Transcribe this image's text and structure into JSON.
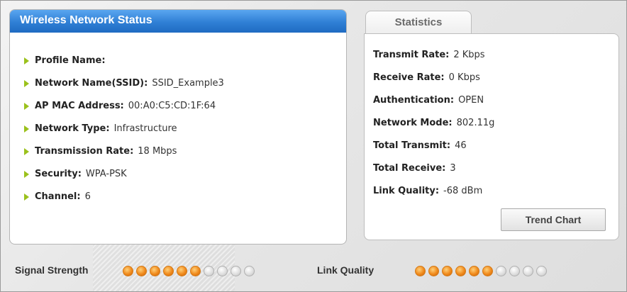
{
  "wireless_status": {
    "title": "Wireless Network Status",
    "items": [
      {
        "label": "Profile Name:",
        "value": ""
      },
      {
        "label": "Network Name(SSID):",
        "value": "SSID_Example3"
      },
      {
        "label": "AP MAC Address:",
        "value": "00:A0:C5:CD:1F:64"
      },
      {
        "label": "Network Type:",
        "value": "Infrastructure"
      },
      {
        "label": "Transmission Rate:",
        "value": "18 Mbps"
      },
      {
        "label": "Security:",
        "value": "WPA-PSK"
      },
      {
        "label": "Channel:",
        "value": "6"
      }
    ]
  },
  "statistics": {
    "tab_label": "Statistics",
    "items": [
      {
        "label": "Transmit Rate:",
        "value": "2 Kbps"
      },
      {
        "label": "Receive Rate:",
        "value": "0 Kbps"
      },
      {
        "label": "Authentication:",
        "value": "OPEN"
      },
      {
        "label": "Network Mode:",
        "value": "802.11g"
      },
      {
        "label": "Total Transmit:",
        "value": "46"
      },
      {
        "label": "Total Receive:",
        "value": "3"
      },
      {
        "label": "Link Quality:",
        "value": "-68 dBm"
      }
    ],
    "trend_chart_label": "Trend Chart"
  },
  "meters": {
    "signal_strength": {
      "label": "Signal Strength",
      "level": 6,
      "total": 10
    },
    "link_quality": {
      "label": "Link Quality",
      "level": 6,
      "total": 10
    }
  },
  "colors": {
    "header_blue": "#2f7fd5",
    "bullet_green": "#9bc11c",
    "dot_active": "#f08a1c",
    "dot_inactive": "#dcdcdc"
  }
}
